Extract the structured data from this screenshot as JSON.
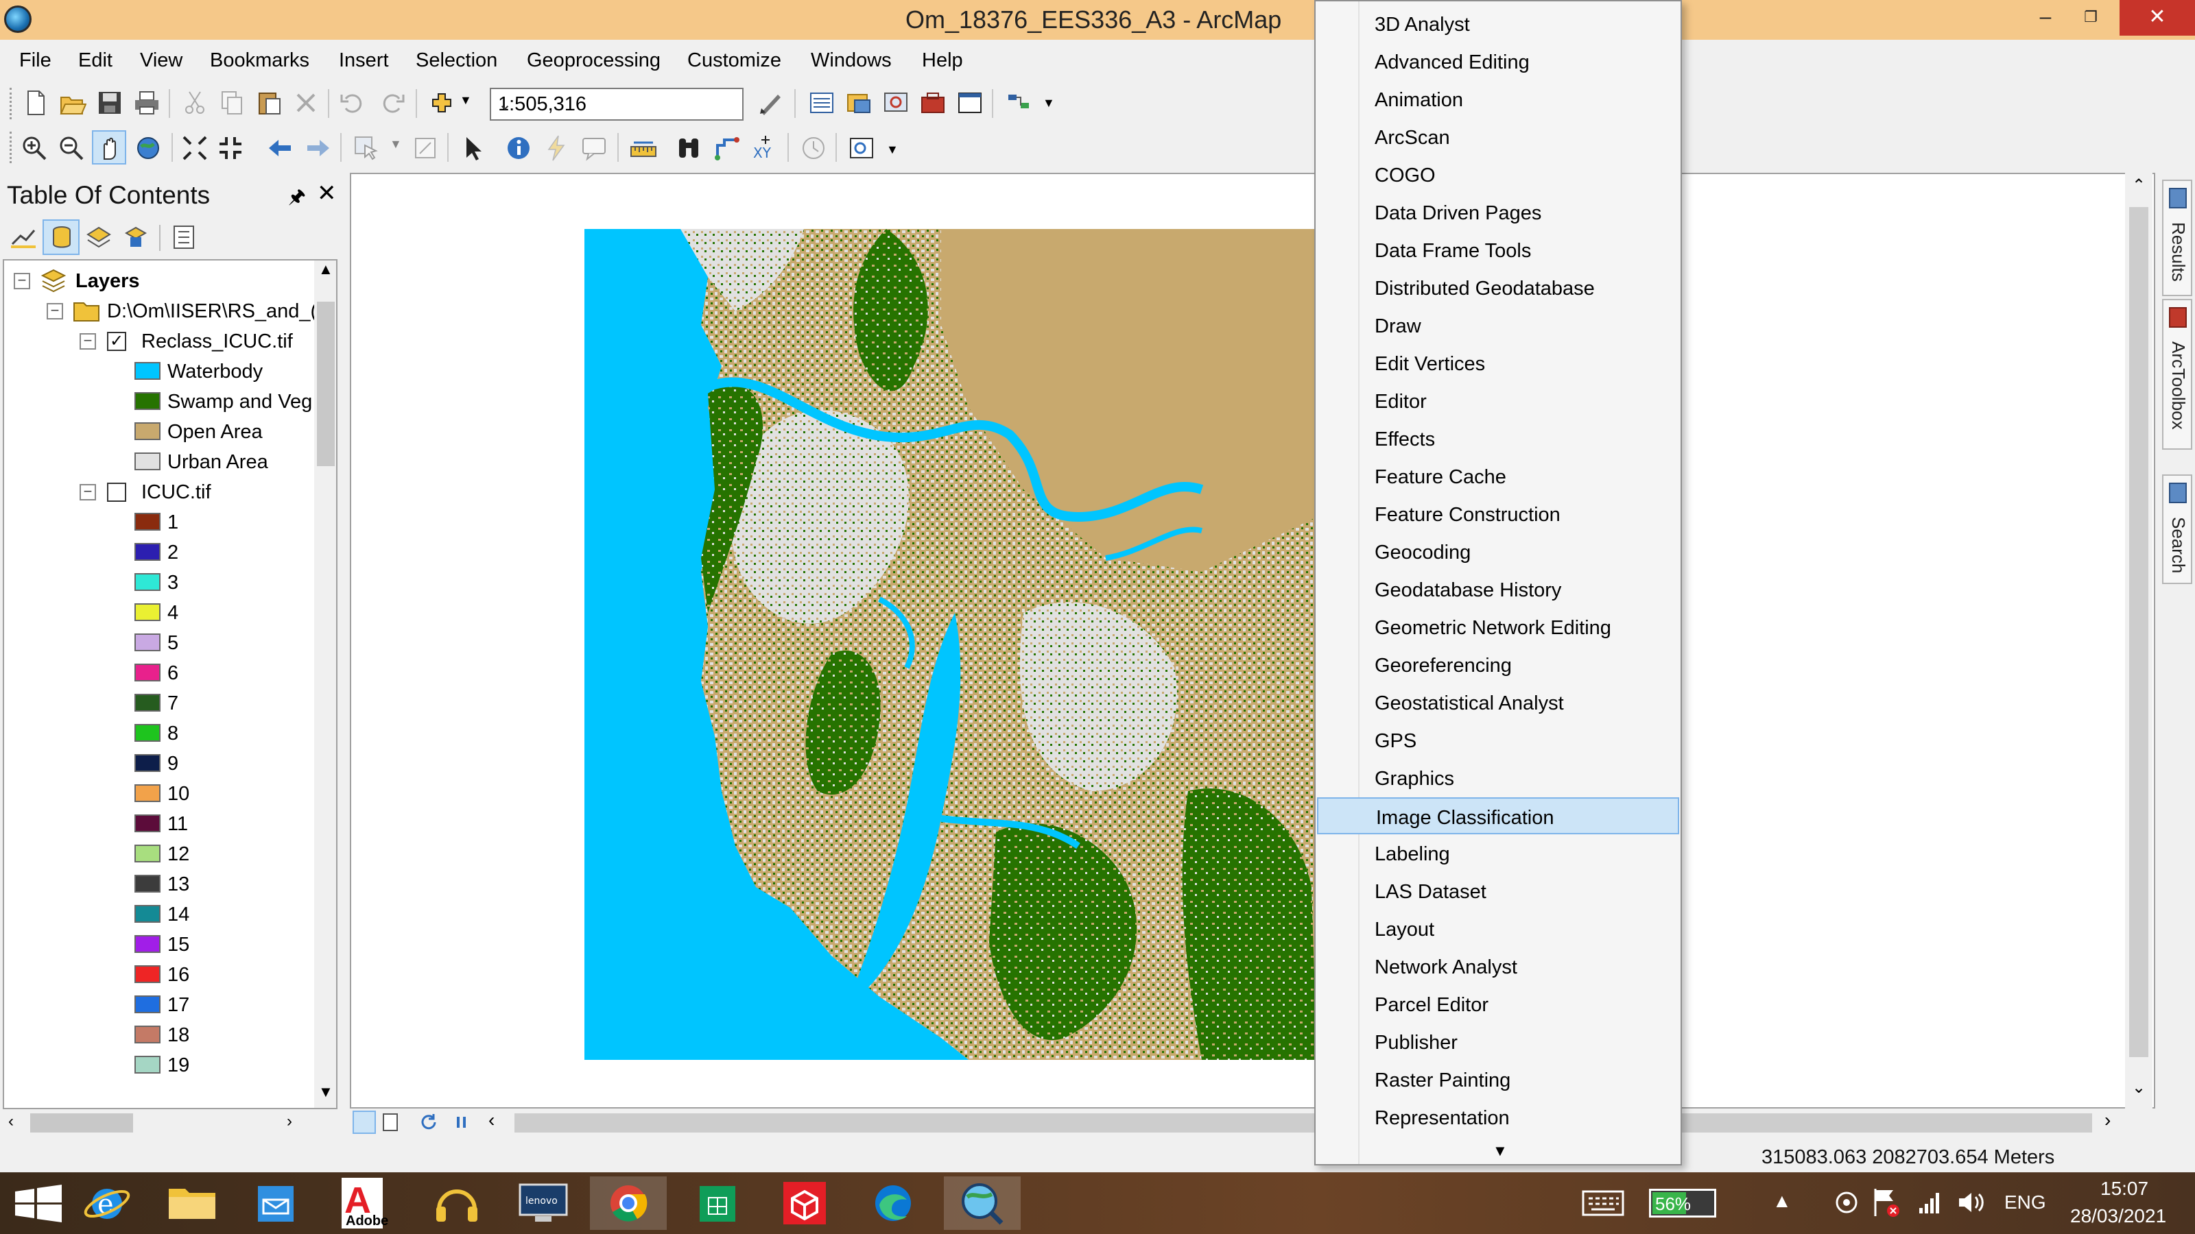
{
  "window": {
    "title": "Om_18376_EES336_A3 - ArcMap",
    "controls": {
      "minimize": "–",
      "restore": "❐",
      "close": "✕"
    }
  },
  "menubar": [
    "File",
    "Edit",
    "View",
    "Bookmarks",
    "Insert",
    "Selection",
    "Geoprocessing",
    "Customize",
    "Windows",
    "Help"
  ],
  "toolbar": {
    "scale_value": "1:505,316",
    "icons_row1": [
      "new-document-icon",
      "open-icon",
      "save-icon",
      "print-icon",
      "cut-icon",
      "copy-icon",
      "paste-icon",
      "delete-icon",
      "undo-icon",
      "redo-icon",
      "add-data-icon",
      "editor-toolbar-icon",
      "table-of-contents-icon",
      "catalog-icon",
      "search-window-icon",
      "arctoolbox-icon",
      "python-icon",
      "model-builder-icon"
    ],
    "icons_row2": [
      "zoom-in-icon",
      "zoom-out-icon",
      "pan-icon",
      "full-extent-icon",
      "fixed-zoom-in-icon",
      "fixed-zoom-out-icon",
      "back-extent-icon",
      "forward-extent-icon",
      "select-features-icon",
      "clear-selection-icon",
      "select-elements-icon",
      "identify-icon",
      "hyperlink-icon",
      "html-popup-icon",
      "measure-icon",
      "find-icon",
      "find-route-icon",
      "go-to-xy-icon",
      "time-slider-icon",
      "create-viewer-window-icon"
    ]
  },
  "toc": {
    "title": "Table Of Contents",
    "pin": "🖈",
    "close": "✕",
    "tree": {
      "layers_label": "Layers",
      "folder_label": "D:\\Om\\IISER\\RS_and_(",
      "reclass_layer": {
        "name": "Reclass_ICUC.tif",
        "checked": true,
        "classes": [
          {
            "label": "Waterbody",
            "color": "#00c5ff"
          },
          {
            "label": "Swamp and Veg",
            "color": "#267300"
          },
          {
            "label": "Open Area",
            "color": "#c8a96e"
          },
          {
            "label": "Urban Area",
            "color": "#e1e1e1"
          }
        ]
      },
      "icuc_layer": {
        "name": "ICUC.tif",
        "checked": false,
        "classes": [
          {
            "label": "1",
            "color": "#8a2b0e"
          },
          {
            "label": "2",
            "color": "#2c1fb0"
          },
          {
            "label": "3",
            "color": "#2ee8d6"
          },
          {
            "label": "4",
            "color": "#eaf032"
          },
          {
            "label": "5",
            "color": "#c9a9e3"
          },
          {
            "label": "6",
            "color": "#e8218c"
          },
          {
            "label": "7",
            "color": "#265c1f"
          },
          {
            "label": "8",
            "color": "#1ec41e"
          },
          {
            "label": "9",
            "color": "#0d1e4a"
          },
          {
            "label": "10",
            "color": "#f2a24a"
          },
          {
            "label": "11",
            "color": "#5c0c3a"
          },
          {
            "label": "12",
            "color": "#a8de7f"
          },
          {
            "label": "13",
            "color": "#3c3c3c"
          },
          {
            "label": "14",
            "color": "#148a95"
          },
          {
            "label": "15",
            "color": "#a11ee8"
          },
          {
            "label": "16",
            "color": "#ee2525"
          },
          {
            "label": "17",
            "color": "#1f6ee0"
          },
          {
            "label": "18",
            "color": "#c47a66"
          },
          {
            "label": "19",
            "color": "#a5d6c4"
          }
        ]
      }
    }
  },
  "side_panel": [
    "Results",
    "ArcToolbox",
    "Search"
  ],
  "status": {
    "coordinates": "315083.063  2082703.654 Meters"
  },
  "dropdown": {
    "items": [
      "3D Analyst",
      "Advanced Editing",
      "Animation",
      "ArcScan",
      "COGO",
      "Data Driven Pages",
      "Data Frame Tools",
      "Distributed Geodatabase",
      "Draw",
      "Edit Vertices",
      "Editor",
      "Effects",
      "Feature Cache",
      "Feature Construction",
      "Geocoding",
      "Geodatabase History",
      "Geometric Network Editing",
      "Georeferencing",
      "Geostatistical Analyst",
      "GPS",
      "Graphics",
      "Image Classification",
      "Labeling",
      "LAS Dataset",
      "Layout",
      "Network Analyst",
      "Parcel Editor",
      "Publisher",
      "Raster Painting",
      "Representation"
    ],
    "highlighted": "Image Classification",
    "more_arrow": "▼"
  },
  "taskbar": {
    "apps": [
      "start-icon",
      "internet-explorer-icon",
      "file-explorer-icon",
      "outlook-icon",
      "adobe-icon",
      "headphones-icon",
      "lenovo-icon",
      "chrome-icon",
      "store-icon",
      "3d-box-icon",
      "edge-icon",
      "arcmap-icon"
    ],
    "adobe_label": "Adobe",
    "battery": "56%",
    "battery_level": 0.56,
    "language": "ENG",
    "time": "15:07",
    "date": "28/03/2021"
  }
}
